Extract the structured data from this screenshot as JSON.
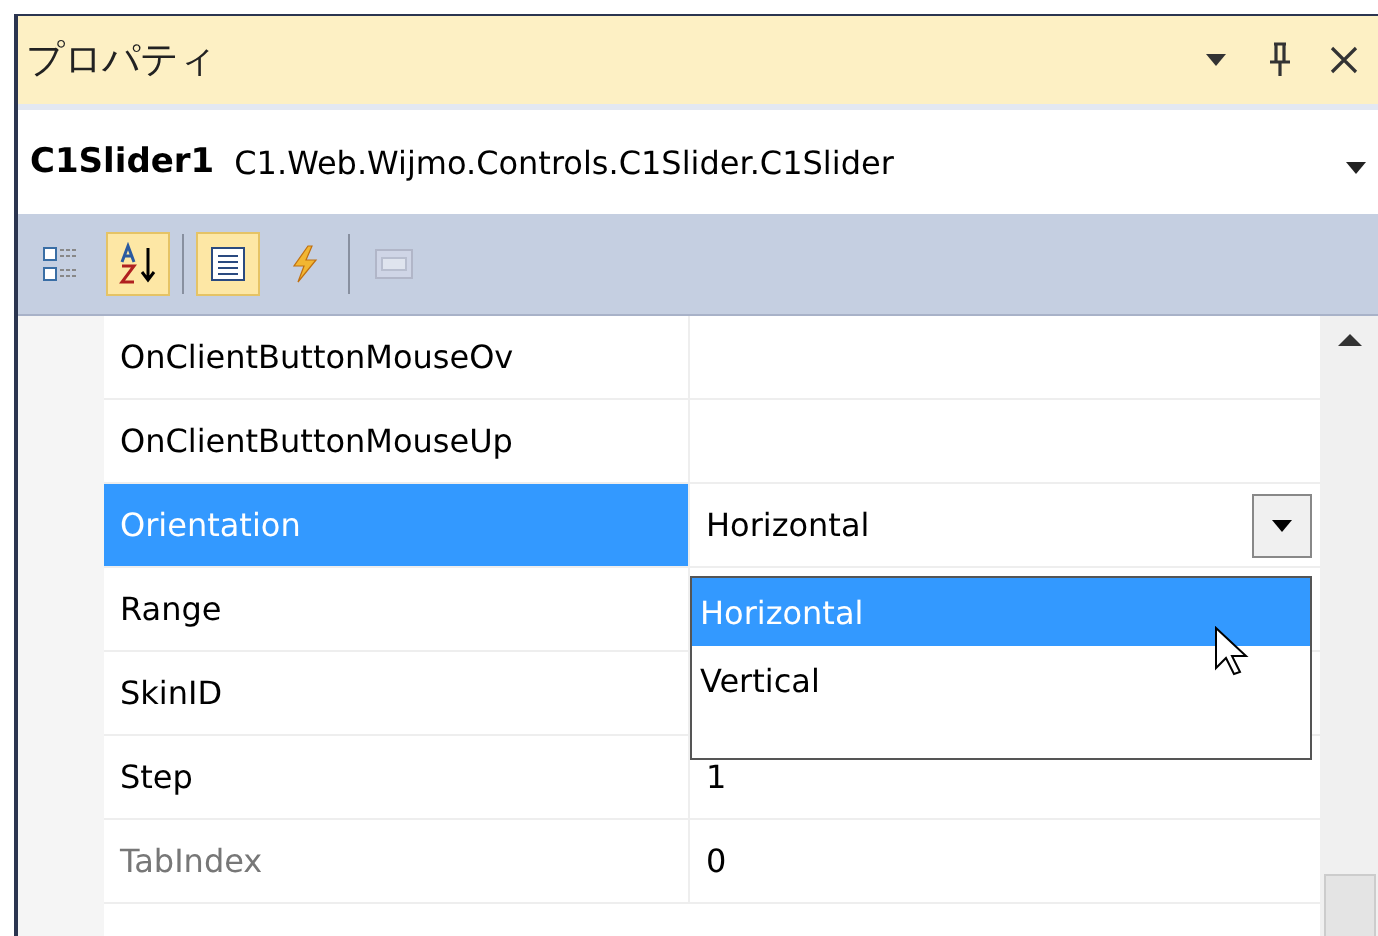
{
  "window": {
    "title": "プロパティ"
  },
  "object_selector": {
    "name": "C1Slider1",
    "type": "C1.Web.Wijmo.Controls.C1Slider.C1Slider"
  },
  "toolbar": [
    {
      "kind": "categorized",
      "selected": false,
      "disabled": false
    },
    {
      "kind": "alphabetical",
      "selected": true,
      "disabled": false
    },
    {
      "kind": "properties",
      "selected": true,
      "disabled": false
    },
    {
      "kind": "events",
      "selected": false,
      "disabled": false
    },
    {
      "kind": "property-pages",
      "selected": false,
      "disabled": true
    }
  ],
  "properties": [
    {
      "name": "OnClientButtonMouseOv",
      "selected": false,
      "disabled": false
    },
    {
      "name": "OnClientButtonMouseUp",
      "selected": false,
      "disabled": false
    },
    {
      "name": "Orientation",
      "value": "Horizontal",
      "selected": true,
      "disabled": false,
      "dropdown": [
        {
          "label": "Horizontal",
          "selected": true
        },
        {
          "label": "Vertical",
          "selected": false
        }
      ]
    },
    {
      "name": "Range",
      "selected": false,
      "disabled": false
    },
    {
      "name": "SkinID",
      "selected": false,
      "disabled": false
    },
    {
      "name": "Step",
      "value": "1",
      "selected": false,
      "disabled": false
    },
    {
      "name": "TabIndex",
      "value": "0",
      "selected": false,
      "disabled": true
    }
  ]
}
